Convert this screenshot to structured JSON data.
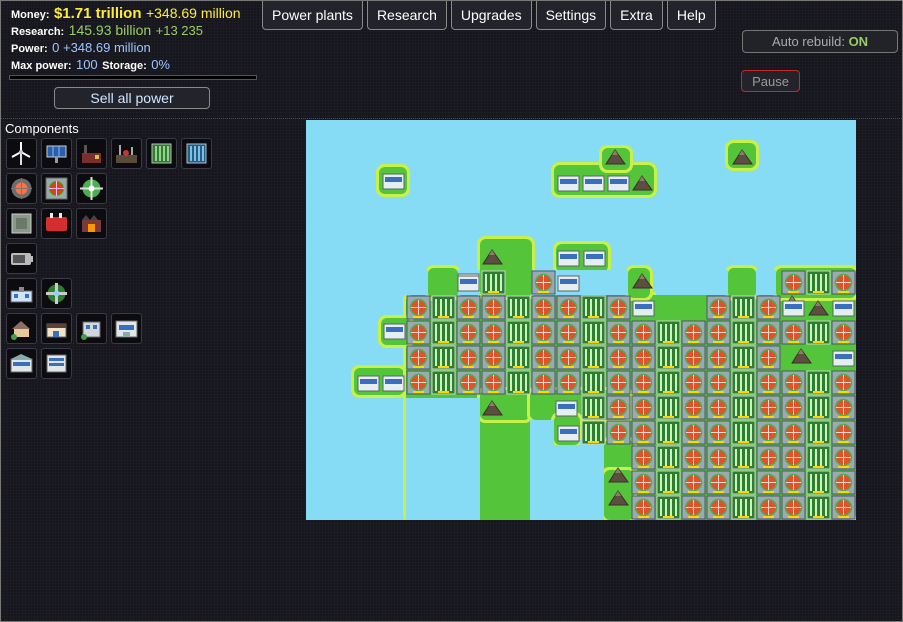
{
  "stats": {
    "money_label": "Money:",
    "money": "$1.71 trillion",
    "money_gain": "+348.69 million",
    "research_label": "Research:",
    "research": "145.93 billion",
    "research_gain": "+13 235",
    "power_label": "Power:",
    "power": "0 +348.69 million",
    "maxpower_label": "Max power:",
    "maxpower": "100",
    "storage_label": "Storage:",
    "storage": "0%",
    "power_storage_fill": 0
  },
  "sell_label": "Sell all power",
  "menu": [
    "Power plants",
    "Research",
    "Upgrades",
    "Settings",
    "Extra",
    "Help"
  ],
  "auto_label": "Auto rebuild:",
  "auto_state": "ON",
  "pause_label": "Pause",
  "components_title": "Components",
  "palette_rows": [
    [
      "wind-turbine-icon",
      "solar-panel-icon",
      "coal-plant-icon",
      "oil-refinery-icon",
      "geothermal-plant-icon",
      "water-pump-icon"
    ],
    [
      "reactor-icon",
      "reactor-core-icon",
      "heat-exchanger-icon"
    ],
    [
      "heat-sink-icon",
      "red-generator-icon",
      "furnace-icon"
    ],
    [
      "battery-icon"
    ],
    [
      "office-icon",
      "cooling-fan-icon"
    ],
    [
      "house-icon",
      "shop-icon",
      "small-office-icon",
      "office-block-icon"
    ],
    [
      "bank-icon",
      "large-office-icon"
    ]
  ],
  "colors": {
    "money": "#ffeb3b",
    "research": "#9ccc65",
    "power": "#9fc5ff",
    "auto_on": "#9ccc65",
    "pause_border": "#c62828",
    "water": "#86dcf4",
    "grass": "#54c43a"
  }
}
